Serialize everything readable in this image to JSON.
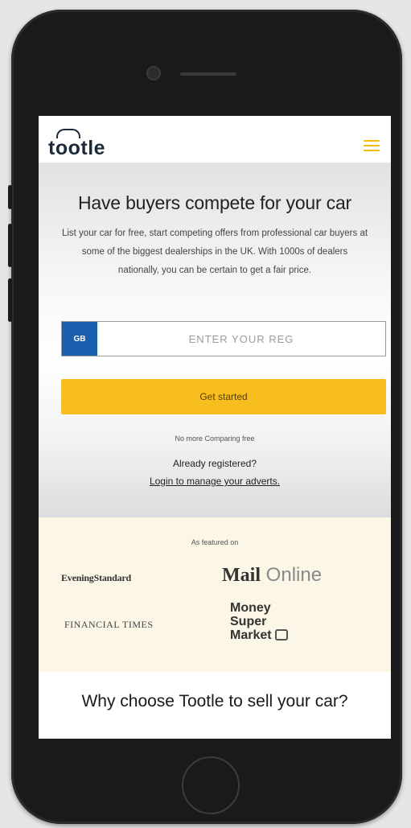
{
  "header": {
    "logo_text": "tootle",
    "menu_icon": "hamburger-menu-icon"
  },
  "hero": {
    "title": "Have buyers compete for your car",
    "description": "List your car for free, start competing offers from professional car buyers at some of the biggest dealerships in the UK. With 1000s of dealers nationally, you can be certain to get a fair price.",
    "reg_badge": "GB",
    "reg_placeholder": "ENTER YOUR REG",
    "cta_label": "Get started",
    "small_note": "No more Comparing free",
    "already_registered": "Already registered?",
    "login_link": "Login to manage your adverts."
  },
  "featured": {
    "label": "As featured on",
    "brands": {
      "evening_standard": "EveningStandard",
      "mail_part1": "Mail",
      "mail_part2": "Online",
      "financial_times": "FINANCIAL TIMES",
      "msm_line1": "Money",
      "msm_line2": "Super",
      "msm_line3": "Market"
    }
  },
  "why": {
    "title": "Why choose Tootle to sell your car?"
  },
  "colors": {
    "accent_yellow": "#f8bd1f",
    "badge_blue": "#1a5fae",
    "featured_bg": "#fbf6e6",
    "phone_body": "#1a1a1a"
  }
}
